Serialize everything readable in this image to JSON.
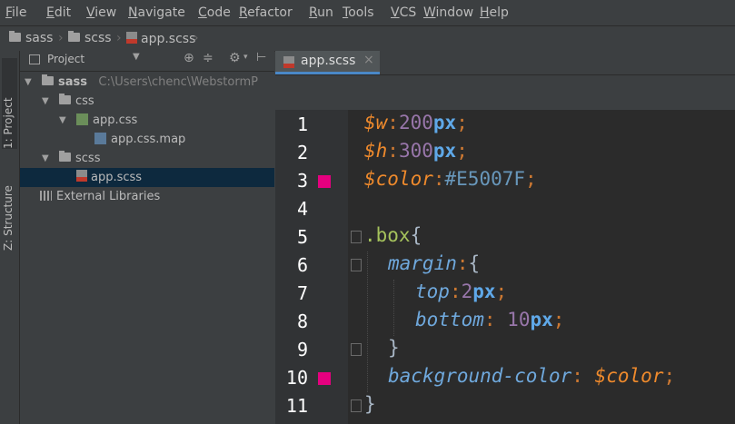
{
  "menu": [
    "File",
    "Edit",
    "View",
    "Navigate",
    "Code",
    "Refactor",
    "Run",
    "Tools",
    "VCS",
    "Window",
    "Help"
  ],
  "breadcrumb": {
    "items": [
      "sass",
      "scss",
      "app.scss"
    ]
  },
  "side_tabs": {
    "project": "1: Project",
    "structure": "Z: Structure"
  },
  "project_panel": {
    "title": "Project"
  },
  "tree": {
    "root": {
      "name": "sass",
      "path": "C:\\Users\\chenc\\WebstormP"
    },
    "css": "css",
    "app_css": "app.css",
    "app_css_map": "app.css.map",
    "scss": "scss",
    "app_scss": "app.scss",
    "external": "External Libraries"
  },
  "editor": {
    "tab_label": "app.scss",
    "tab_close": "×",
    "swatch_color": "#E5007F",
    "line_numbers": [
      "1",
      "2",
      "3",
      "4",
      "5",
      "6",
      "7",
      "8",
      "9",
      "10",
      "11"
    ],
    "tokens": {
      "l1_var": "$w",
      "l1_colon": ":",
      "l1_num": "200",
      "l1_unit": "px",
      "l1_semi": ";",
      "l2_var": "$h",
      "l2_colon": ":",
      "l2_num": "300",
      "l2_unit": "px",
      "l2_semi": ";",
      "l3_var": "$color",
      "l3_colon": ":",
      "l3_hex": "#E5007F",
      "l3_semi": ";",
      "l5_sel": ".box",
      "l5_brace": "{",
      "l6_prop": "margin",
      "l6_colon": ":",
      "l6_brace": "{",
      "l7_prop": "top",
      "l7_colon": ":",
      "l7_num": "2",
      "l7_unit": "px",
      "l7_semi": ";",
      "l8_prop": "bottom",
      "l8_colon": ":",
      "l8_num": "10",
      "l8_unit": "px",
      "l8_semi": ";",
      "l9_brace": "}",
      "l10_prop": "background-color",
      "l10_colon": ":",
      "l10_var": "$color",
      "l10_semi": ";",
      "l11_brace": "}"
    }
  }
}
